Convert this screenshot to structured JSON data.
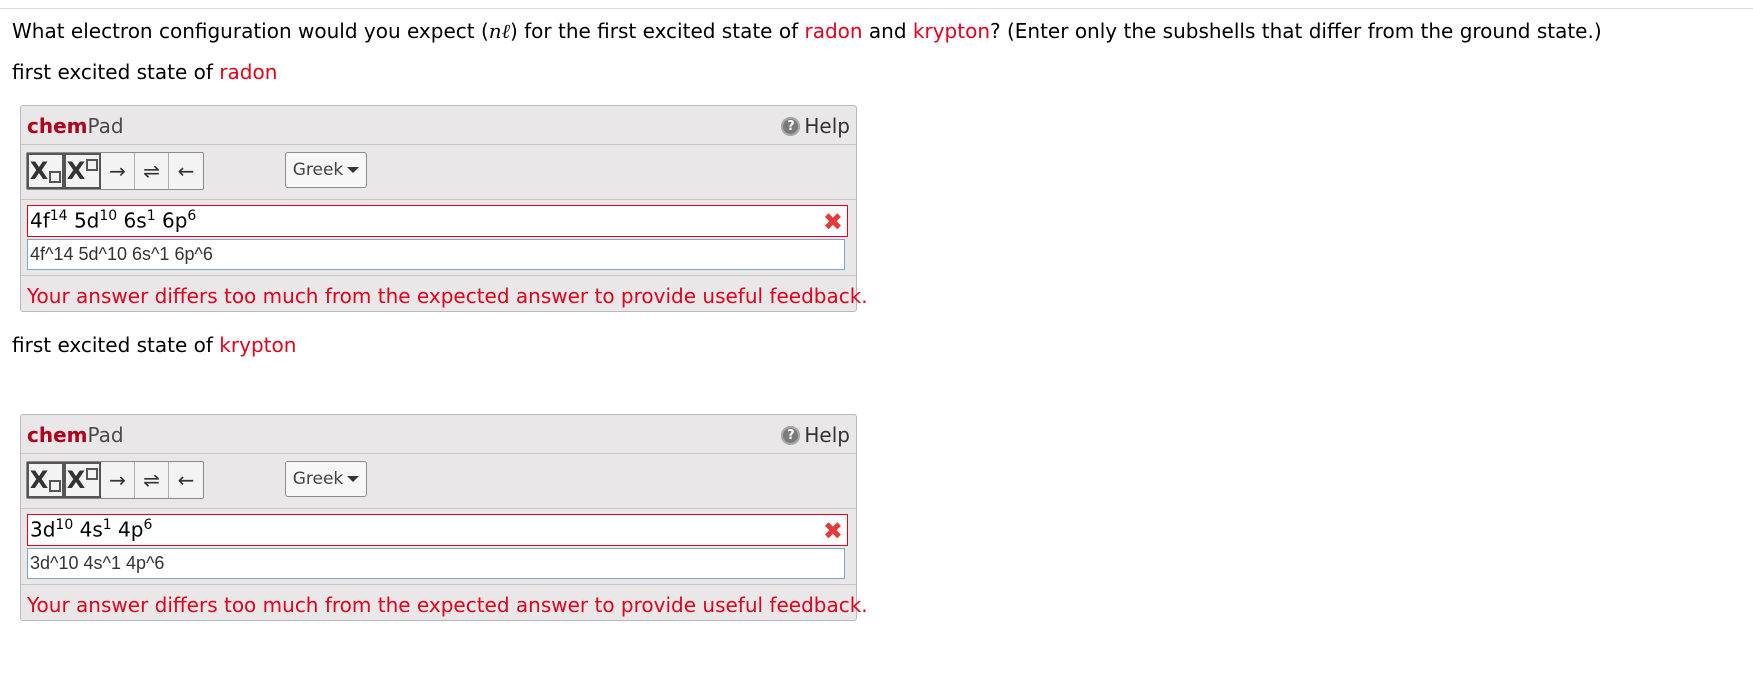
{
  "question": {
    "prefix": "What electron configuration would you expect (",
    "nl": "nℓ",
    "mid": ") for the first excited state of ",
    "element1": "radon",
    "and": " and ",
    "element2": "krypton",
    "suffix": "? (Enter only the subshells that differ from the ground state.)"
  },
  "parts": [
    {
      "label_prefix": "first excited state of ",
      "label_element": "radon",
      "chempad": {
        "title_chem": "chem",
        "title_pad": "Pad",
        "help_label": "Help",
        "greek_label": "Greek",
        "rendered_answer": [
          {
            "base": "4f",
            "sup": "14"
          },
          {
            "base": " 5d",
            "sup": "10"
          },
          {
            "base": " 6s",
            "sup": "1"
          },
          {
            "base": " 6p",
            "sup": "6"
          }
        ],
        "raw_value": "4f^14 5d^10 6s^1 6p^6",
        "feedback": "Your answer differs too much from the expected answer to provide useful feedback."
      }
    },
    {
      "label_prefix": "first excited state of ",
      "label_element": "krypton",
      "chempad": {
        "title_chem": "chem",
        "title_pad": "Pad",
        "help_label": "Help",
        "greek_label": "Greek",
        "rendered_answer": [
          {
            "base": "3d",
            "sup": "10"
          },
          {
            "base": " 4s",
            "sup": "1"
          },
          {
            "base": " 4p",
            "sup": "6"
          }
        ],
        "raw_value": "3d^10 4s^1 4p^6",
        "feedback": "Your answer differs too much from the expected answer to provide useful feedback."
      }
    }
  ],
  "toolbar": {
    "subscript_glyph": "X",
    "superscript_glyph": "X",
    "arrow_right": "→",
    "arrow_equilibrium": "⇌",
    "arrow_left": "←"
  },
  "colors": {
    "accent_red": "#e3001b",
    "chem_brand": "#b0001d"
  },
  "icons": {
    "help": "help-circle-icon",
    "error": "x-mark-icon",
    "dropdown": "caret-down-icon"
  }
}
